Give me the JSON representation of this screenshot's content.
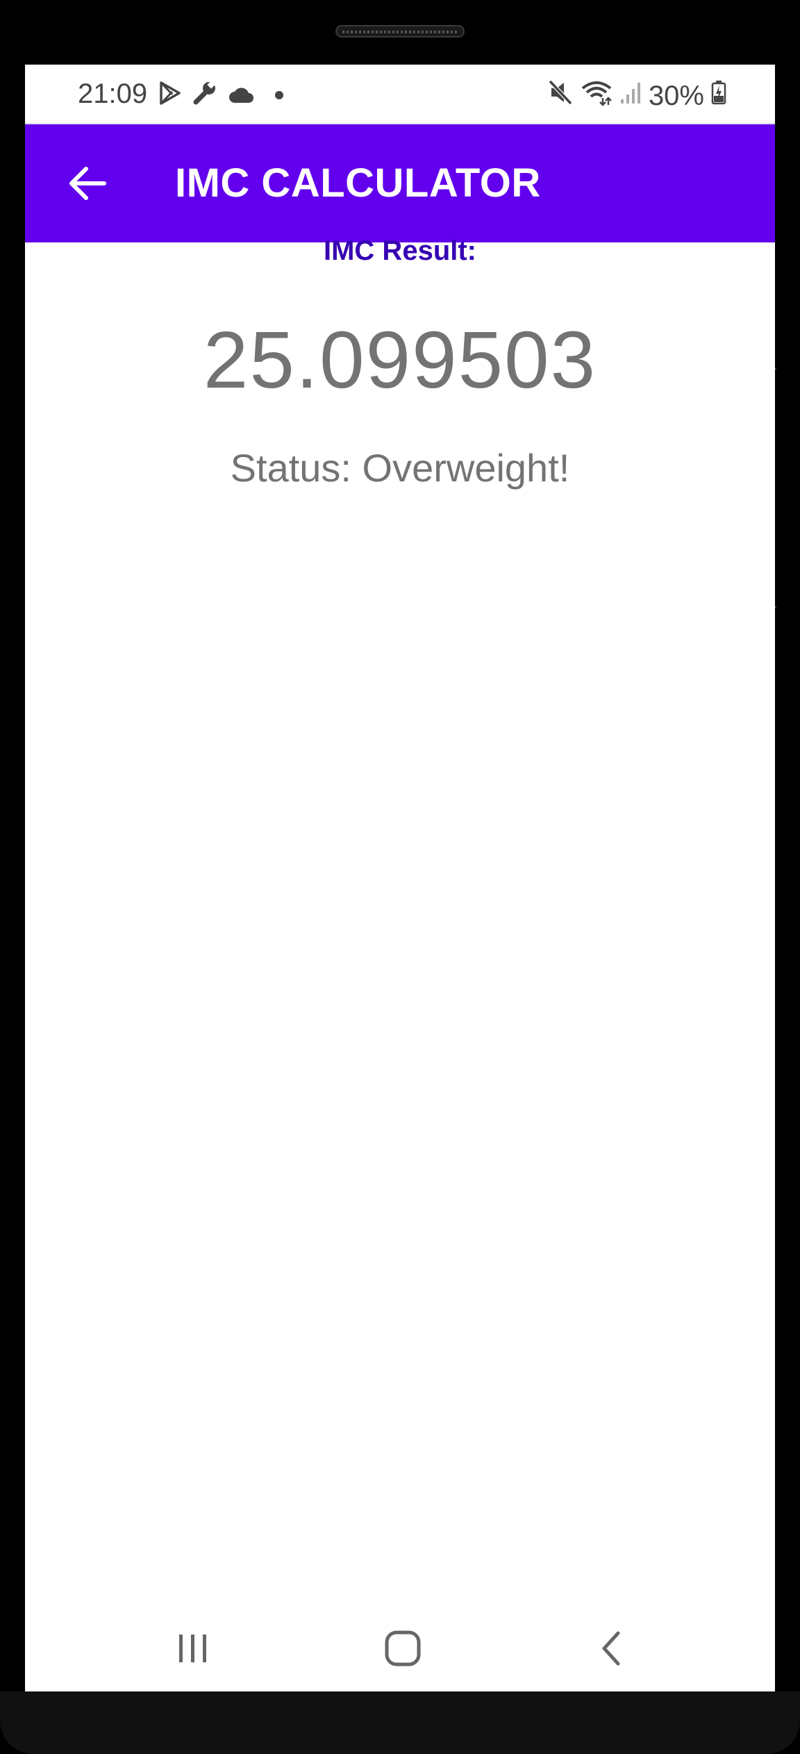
{
  "status_bar": {
    "time": "21:09",
    "battery_percent": "30%",
    "left_icons": [
      "play-store-icon",
      "wrench-icon",
      "cloud-icon",
      "dot-icon"
    ],
    "right_icons": [
      "mute-icon",
      "wifi-icon",
      "signal-icon",
      "battery-charging-icon"
    ]
  },
  "app_bar": {
    "title": "IMC CALCULATOR",
    "back_icon": "arrow-back-icon",
    "background_color": "#6200ee"
  },
  "content": {
    "result_label": "IMC Result:",
    "result_value": "25.099503",
    "status": "Status: Overweight!",
    "label_color": "#3700b3"
  },
  "nav_bar": {
    "buttons": [
      "recents-icon",
      "home-icon",
      "back-icon"
    ]
  }
}
